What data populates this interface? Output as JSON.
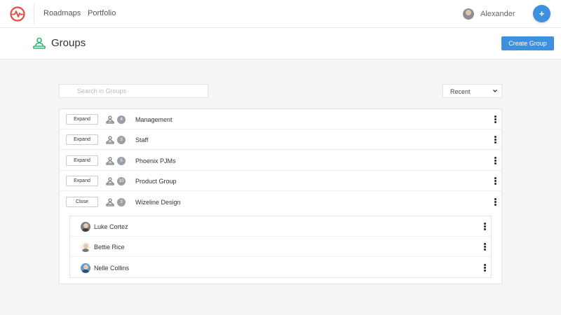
{
  "colors": {
    "accent": "#3d8fe0",
    "logo": "#e8483d",
    "group_icon": "#2bb673"
  },
  "nav": {
    "logo_icon": "pulse-logo-icon",
    "items": [
      "Roadmaps",
      "Portfolio"
    ],
    "user_name": "Alexander",
    "add_label": "+"
  },
  "page": {
    "title": "Groups",
    "icon": "group-icon",
    "create_label": "Create Group"
  },
  "search": {
    "placeholder": "Search in Groups"
  },
  "sort": {
    "selected": "Recent"
  },
  "groups": [
    {
      "name": "Management",
      "count": "4",
      "action": "Expand"
    },
    {
      "name": "Staff",
      "count": "3",
      "action": "Expand"
    },
    {
      "name": "Phoenix PJMs",
      "count": "5",
      "action": "Expand"
    },
    {
      "name": "Product Group",
      "count": "10",
      "action": "Expand"
    },
    {
      "name": "Wizeline Design",
      "count": "3",
      "action": "Close"
    }
  ],
  "members": [
    {
      "name": "Luke Cortez",
      "avatar_color": "#7d7f82"
    },
    {
      "name": "Bettie Rice",
      "avatar_color": "#f2f2f2"
    },
    {
      "name": "Nelle Collins",
      "avatar_color": "#5b9bd5"
    }
  ]
}
